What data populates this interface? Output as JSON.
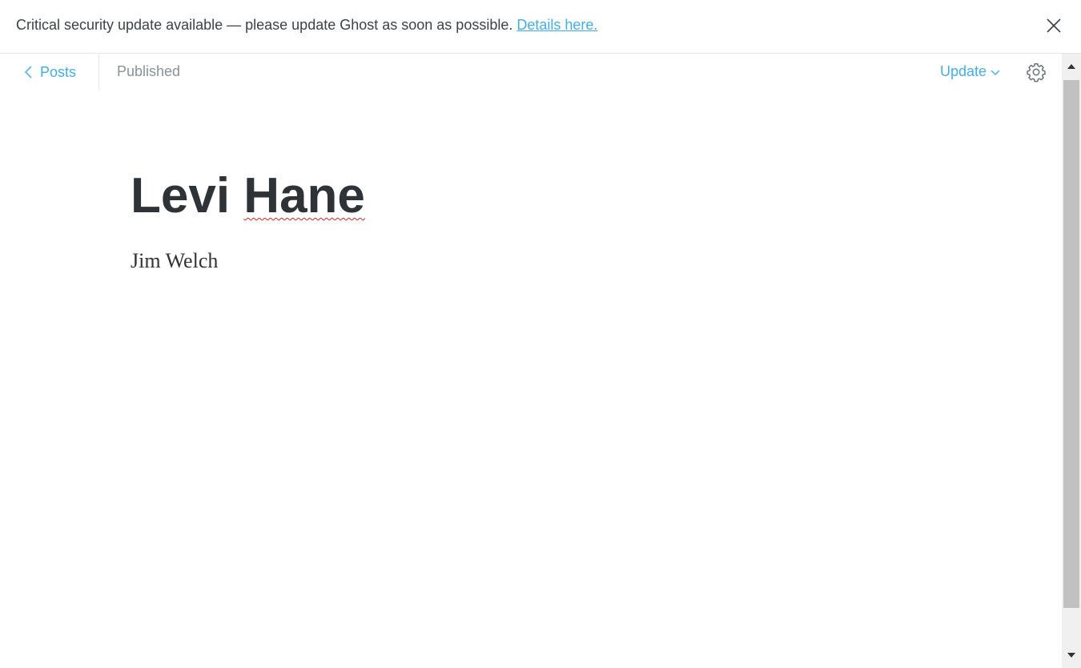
{
  "banner": {
    "message": "Critical security update available — please update Ghost as soon as possible. ",
    "link_label": "Details here.",
    "close_icon": "close-icon"
  },
  "header": {
    "back_label": "Posts",
    "back_icon": "chevron-left-icon",
    "status": "Published",
    "update_label": "Update",
    "update_icon": "chevron-down-icon",
    "settings_icon": "gear-icon"
  },
  "post": {
    "title_first": "Levi",
    "title_second": "Hane",
    "body": "Jim Welch"
  },
  "colors": {
    "accent": "#3eb0ef",
    "title": "#2e3338",
    "muted": "#8a9399",
    "spellcheck": "#e02020"
  }
}
